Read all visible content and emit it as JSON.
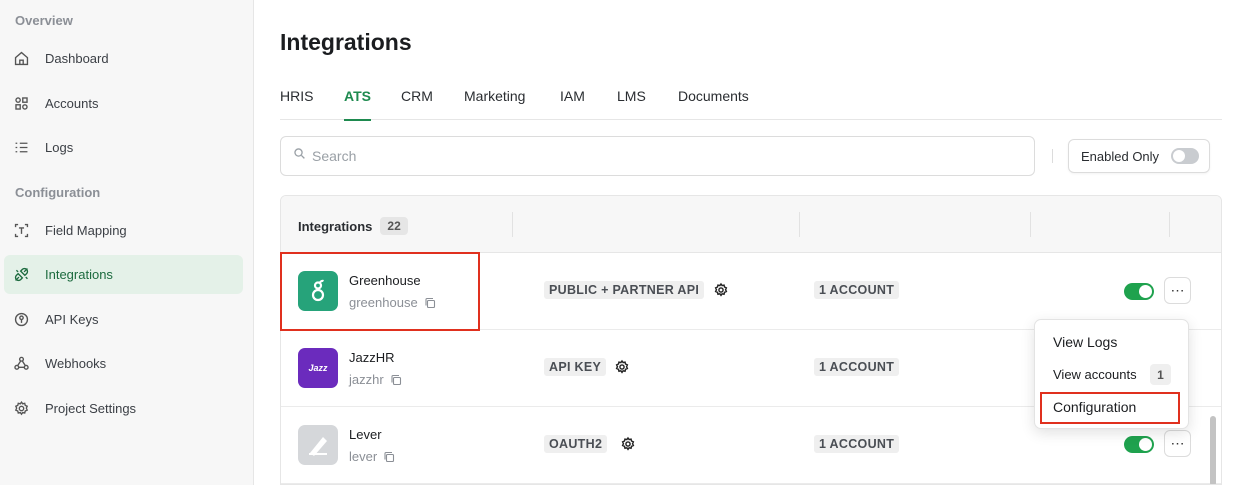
{
  "sidebar": {
    "overview_title": "Overview",
    "configuration_title": "Configuration",
    "items": [
      {
        "label": "Dashboard",
        "icon": "home-icon"
      },
      {
        "label": "Accounts",
        "icon": "grid-icon"
      },
      {
        "label": "Logs",
        "icon": "list-icon"
      },
      {
        "label": "Field Mapping",
        "icon": "text-field-icon"
      },
      {
        "label": "Integrations",
        "icon": "plug-icon",
        "active": true
      },
      {
        "label": "API Keys",
        "icon": "key-icon"
      },
      {
        "label": "Webhooks",
        "icon": "webhook-icon"
      },
      {
        "label": "Project Settings",
        "icon": "gear-icon"
      }
    ]
  },
  "main": {
    "title": "Integrations",
    "tabs": [
      "HRIS",
      "ATS",
      "CRM",
      "Marketing",
      "IAM",
      "LMS",
      "Documents"
    ],
    "active_tab": "ATS",
    "search_placeholder": "Search",
    "enabled_only_label": "Enabled Only",
    "table": {
      "header_label": "Integrations",
      "header_count": "22",
      "rows": [
        {
          "name": "Greenhouse",
          "slug": "greenhouse",
          "auth": "PUBLIC + PARTNER API",
          "accounts": "1 ACCOUNT",
          "enabled": true,
          "logo_color": "#26a37a"
        },
        {
          "name": "JazzHR",
          "slug": "jazzhr",
          "auth": "API KEY",
          "accounts": "1 ACCOUNT",
          "enabled": true,
          "logo_color": "#6b2bbd",
          "logo_text": "Jazz"
        },
        {
          "name": "Lever",
          "slug": "lever",
          "auth": "OAUTH2",
          "accounts": "1 ACCOUNT",
          "enabled": true,
          "logo_color": "#d5d7da"
        }
      ]
    }
  },
  "menu": {
    "view_logs": "View Logs",
    "view_accounts": "View accounts",
    "view_accounts_count": "1",
    "configuration": "Configuration"
  },
  "colors": {
    "accent": "#1e8a4f",
    "highlight": "#e0301e"
  }
}
